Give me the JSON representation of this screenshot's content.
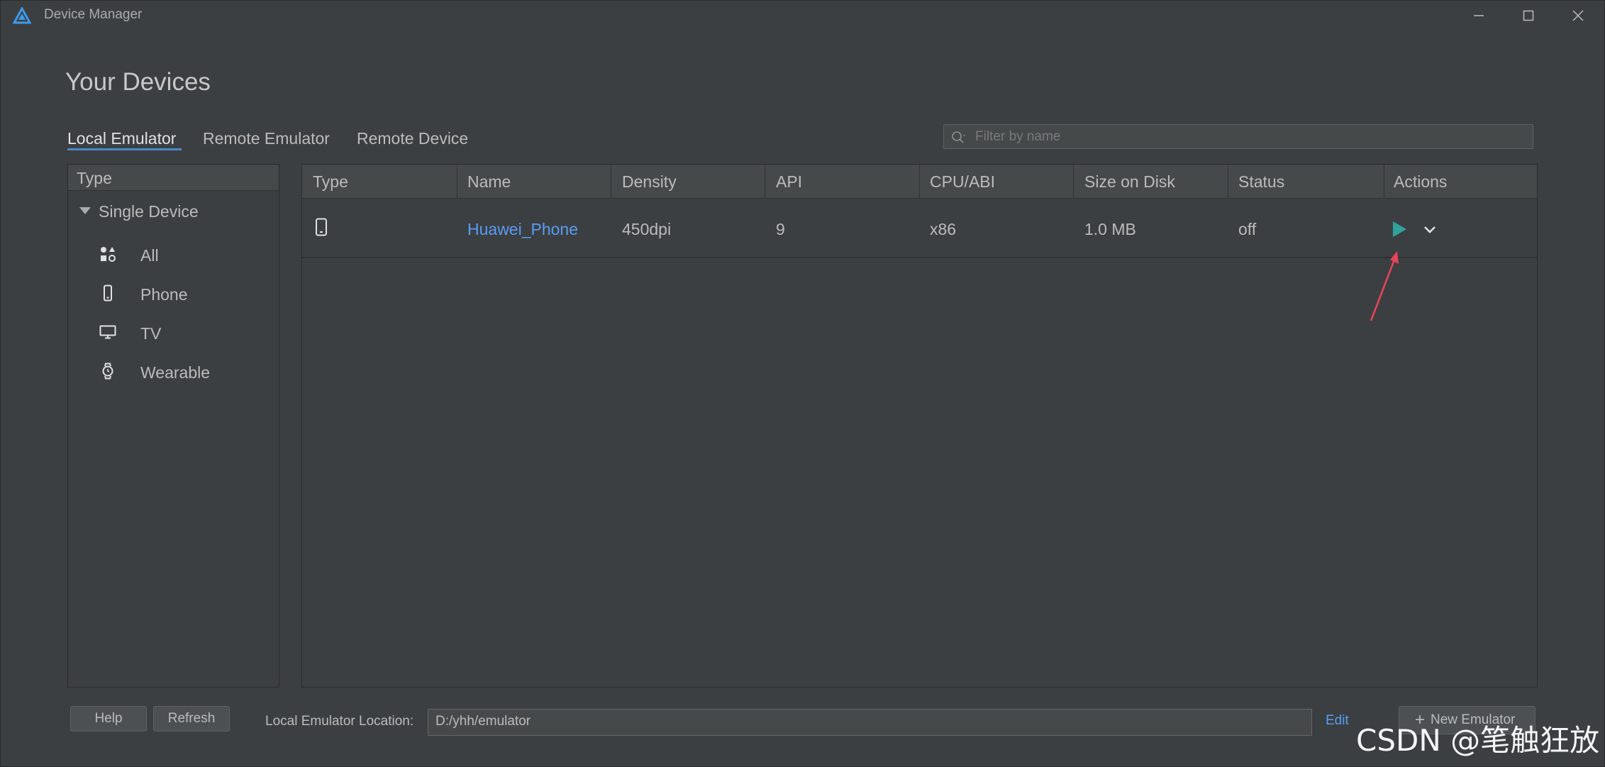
{
  "window": {
    "title": "Device Manager",
    "controls": [
      "minimize",
      "maximize",
      "close"
    ]
  },
  "page": {
    "title": "Your Devices"
  },
  "tabs": [
    {
      "label": "Local Emulator",
      "active": true
    },
    {
      "label": "Remote Emulator",
      "active": false
    },
    {
      "label": "Remote Device",
      "active": false
    }
  ],
  "search": {
    "placeholder": "Filter by name",
    "value": ""
  },
  "sidebar": {
    "header": "Type",
    "group": "Single Device",
    "items": [
      {
        "label": "All",
        "icon": "all-shapes-icon"
      },
      {
        "label": "Phone",
        "icon": "phone-icon"
      },
      {
        "label": "TV",
        "icon": "tv-icon"
      },
      {
        "label": "Wearable",
        "icon": "watch-icon"
      }
    ]
  },
  "table": {
    "columns": [
      "Type",
      "Name",
      "Density",
      "API",
      "CPU/ABI",
      "Size on Disk",
      "Status",
      "Actions"
    ],
    "rows": [
      {
        "type_icon": "phone-icon",
        "name": "Huawei_Phone",
        "density": "450dpi",
        "api": "9",
        "cpu_abi": "x86",
        "size_on_disk": "1.0 MB",
        "status": "off",
        "actions": [
          "play-icon",
          "chevron-down-icon"
        ]
      }
    ]
  },
  "footer": {
    "help_label": "Help",
    "refresh_label": "Refresh",
    "location_label": "Local Emulator Location:",
    "location_value": "D:/yhh/emulator",
    "edit_label": "Edit",
    "new_emulator_label": "New Emulator"
  },
  "watermark": "CSDN @笔触狂放",
  "colors": {
    "background": "#3c3f41",
    "header": "#45494a",
    "text": "#bbbbbb",
    "link": "#589df6",
    "accent_underline": "#4a88c7",
    "play": "#2fa39b",
    "annotation_arrow": "#e8445a"
  }
}
